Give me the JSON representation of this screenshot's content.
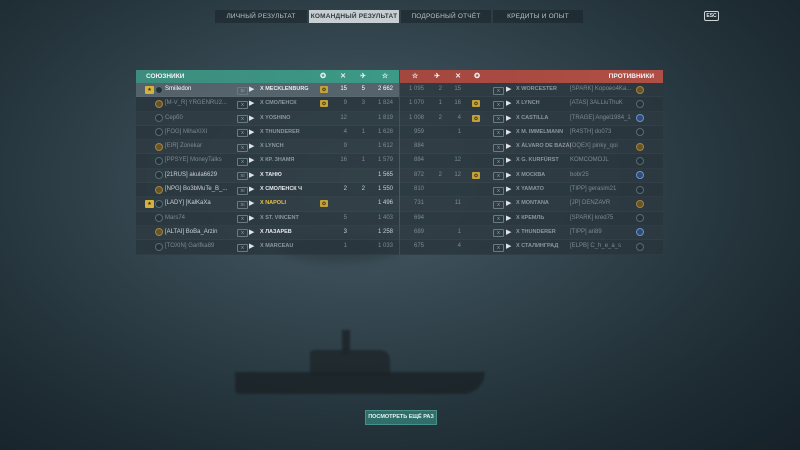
{
  "tabs": [
    {
      "label": "ЛИЧНЫЙ РЕЗУЛЬТАТ",
      "active": false
    },
    {
      "label": "КОМАНДНЫЙ РЕЗУЛЬТАТ",
      "active": true
    },
    {
      "label": "ПОДРОБНЫЙ ОТЧЁТ",
      "active": false
    },
    {
      "label": "КРЕДИТЫ И ОПЫТ",
      "active": false
    }
  ],
  "esc_label": "ESC",
  "allies": {
    "title": "СОЮЗНИКИ",
    "header_icons": [
      "medal-icon",
      "guns-icon",
      "plane-icon",
      "star-icon"
    ],
    "rows": [
      {
        "player": "Smiiledon",
        "tier": "XI",
        "ship": "X MECKLENBURG",
        "badge": "✪",
        "kills": "15",
        "planes": "5",
        "xp": "2 662",
        "me": true,
        "dead": false,
        "rank": "★"
      },
      {
        "player": "[M-V_R] YRGENRU2...",
        "tier": "X",
        "ship": "X СМОЛЕНСК",
        "badge": "✪",
        "kills": "9",
        "planes": "3",
        "xp": "1 824",
        "dead": true
      },
      {
        "player": "Серб0",
        "tier": "X",
        "ship": "X YOSHINO",
        "badge": "",
        "kills": "12",
        "planes": "",
        "xp": "1 819",
        "dead": true
      },
      {
        "player": "[FOG] MihaXIXI",
        "tier": "X",
        "ship": "X THUNDERER",
        "badge": "",
        "kills": "4",
        "planes": "1",
        "xp": "1 628",
        "dead": true
      },
      {
        "player": "[EIR] Zonekar",
        "tier": "X",
        "ship": "X LYNCH",
        "badge": "",
        "kills": "9",
        "planes": "",
        "xp": "1 612",
        "dead": true
      },
      {
        "player": "[PPSYE] MoneyTalks",
        "tier": "X",
        "ship": "X КР. ЗНАМЯ",
        "badge": "",
        "kills": "16",
        "planes": "1",
        "xp": "1 579",
        "dead": true
      },
      {
        "player": "[21RUS] akula6629",
        "tier": "XI",
        "ship": "X ТАНЮ",
        "badge": "",
        "kills": "",
        "planes": "",
        "xp": "1 565",
        "dead": false
      },
      {
        "player": "[NPG] Bo3bMuTe_B_...",
        "tier": "XI",
        "ship": "X СМОЛЕНСК Ч",
        "badge": "",
        "kills": "2",
        "planes": "2",
        "xp": "1 550",
        "dead": false
      },
      {
        "player": "[LADY] [KalKaXa",
        "tier": "XI",
        "ship": "X NAPOLI",
        "badge": "✪",
        "kills": "",
        "planes": "",
        "xp": "1 496",
        "dead": false,
        "gold": true,
        "rank": "★"
      },
      {
        "player": "Mars74",
        "tier": "X",
        "ship": "X ST. VINCENT",
        "badge": "",
        "kills": "5",
        "planes": "",
        "xp": "1 403",
        "dead": true
      },
      {
        "player": "[ALTAI] BoBa_Arzin",
        "tier": "X",
        "ship": "X ЛАЗАРЕВ",
        "badge": "",
        "kills": "3",
        "planes": "",
        "xp": "1 258",
        "dead": false
      },
      {
        "player": "[TOXIN] Garifka89",
        "tier": "X",
        "ship": "X MARCEAU",
        "badge": "",
        "kills": "1",
        "planes": "",
        "xp": "1 033",
        "dead": true
      }
    ]
  },
  "enemies": {
    "title": "ПРОТИВНИКИ",
    "header_icons": [
      "star-icon",
      "plane-icon",
      "guns-icon",
      "medal-icon"
    ],
    "rows": [
      {
        "xp": "1 095",
        "planes": "2",
        "kills": "15",
        "badge": "",
        "ship": "X WORCESTER",
        "player": "[SPARK] Kopoeo4Ka...",
        "dead": true
      },
      {
        "xp": "1 070",
        "planes": "1",
        "kills": "16",
        "badge": "✪",
        "ship": "X LYNCH",
        "player": "[ATAS] 3ALLiuThuK",
        "dead": true
      },
      {
        "xp": "1 008",
        "planes": "2",
        "kills": "4",
        "badge": "✪",
        "ship": "X CASTILLA",
        "player": "[TRAGE] Angel1984_1",
        "dead": true
      },
      {
        "xp": "959",
        "planes": "",
        "kills": "1",
        "badge": "",
        "ship": "X M. IMMELMANN",
        "player": "[R4STH] do073",
        "dead": true
      },
      {
        "xp": "884",
        "planes": "",
        "kills": "",
        "badge": "",
        "ship": "X ÁLVARO DE BAZÁN",
        "player": "[OQEX] pinky_qoi",
        "dead": true
      },
      {
        "xp": "884",
        "planes": "",
        "kills": "12",
        "badge": "",
        "ship": "X G. KURFÜRST",
        "player": "KOMCOMOJL",
        "dead": true
      },
      {
        "xp": "872",
        "planes": "2",
        "kills": "12",
        "badge": "✪",
        "ship": "X МОСКВА",
        "player": "bobr25",
        "dead": true
      },
      {
        "xp": "810",
        "planes": "",
        "kills": "",
        "badge": "",
        "ship": "X YAMATO",
        "player": "[TIPP] gerasim21",
        "dead": true
      },
      {
        "xp": "731",
        "planes": "",
        "kills": "11",
        "badge": "",
        "ship": "X MONTANA",
        "player": "[JP] DENZAVR",
        "dead": true
      },
      {
        "xp": "694",
        "planes": "",
        "kills": "",
        "badge": "",
        "ship": "X КРЕМЛЬ",
        "player": "[SPARK] kred75",
        "dead": true
      },
      {
        "xp": "689",
        "planes": "",
        "kills": "1",
        "badge": "",
        "ship": "X THUNDERER",
        "player": "[TIPP] ari89",
        "dead": true
      },
      {
        "xp": "675",
        "planes": "",
        "kills": "4",
        "badge": "",
        "ship": "X СТАЛИНГРАД",
        "player": "[ELPB] C_h_e_a_s",
        "dead": true
      }
    ]
  },
  "replay_label": "ПОСМОТРЕТЬ ЕЩЁ РАЗ",
  "colors": {
    "ally_header": "#3c9a87",
    "enemy_header": "#b04f45",
    "gold": "#e8c24a"
  }
}
